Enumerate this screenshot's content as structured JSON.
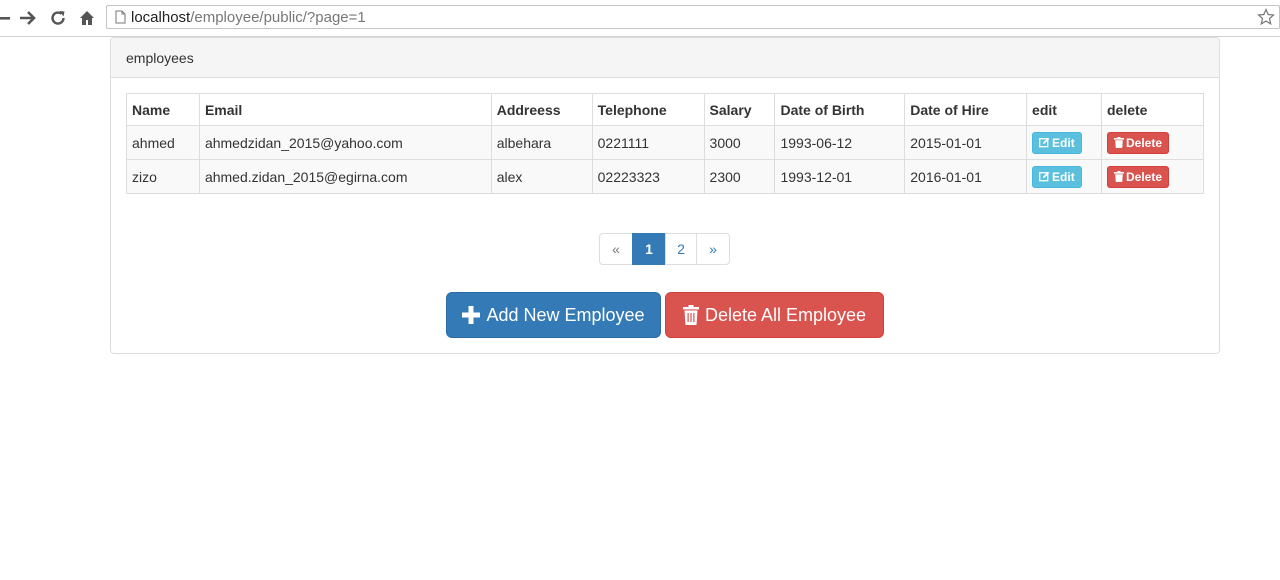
{
  "browser": {
    "url_host": "localhost",
    "url_path": "/employee/public/?page=1",
    "icons": [
      "back-arrow-icon",
      "forward-arrow-icon",
      "reload-icon",
      "home-icon",
      "page-icon",
      "bookmark-star-icon"
    ]
  },
  "panel": {
    "title": "employees"
  },
  "table": {
    "headers": [
      "Name",
      "Email",
      "Addreess",
      "Telephone",
      "Salary",
      "Date of Birth",
      "Date of Hire",
      "edit",
      "delete"
    ],
    "rows": [
      {
        "name": "ahmed",
        "email": "ahmedzidan_2015@yahoo.com",
        "address": "albehara",
        "telephone": "0221111",
        "salary": "3000",
        "dob": "1993-06-12",
        "doh": "2015-01-01",
        "edit": "Edit",
        "delete": "Delete"
      },
      {
        "name": "zizo",
        "email": "ahmed.zidan_2015@egirna.com",
        "address": "alex",
        "telephone": "02223323",
        "salary": "2300",
        "dob": "1993-12-01",
        "doh": "2016-01-01",
        "edit": "Edit",
        "delete": "Delete"
      }
    ]
  },
  "pagination": {
    "prev": "«",
    "pages": [
      "1",
      "2"
    ],
    "active": "1",
    "next": "»"
  },
  "actions": {
    "add": "Add New Employee",
    "delete_all": "Delete All Employee"
  },
  "colors": {
    "primary": "#337ab7",
    "danger": "#d9534f",
    "info": "#5bc0de"
  }
}
